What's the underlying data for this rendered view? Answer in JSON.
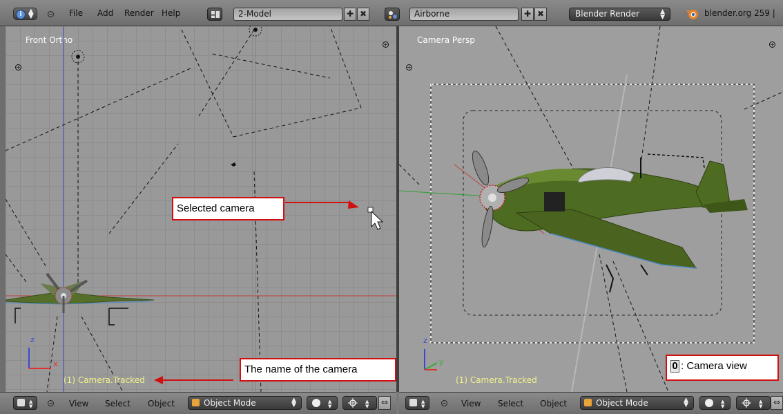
{
  "header": {
    "menu": [
      "File",
      "Add",
      "Render",
      "Help"
    ],
    "screen_layout": "2-Model",
    "scene": "Airborne",
    "render_engine": "Blender Render",
    "version_info": "blender.org 259 |"
  },
  "viewport_left": {
    "name": "Front Ortho",
    "object_label": "(1) Camera.Tracked"
  },
  "viewport_right": {
    "name": "Camera Persp",
    "object_label": "(1) Camera.Tracked"
  },
  "axes": {
    "x": "x",
    "y": "y",
    "z": "z"
  },
  "footer_left": {
    "menu": [
      "View",
      "Select",
      "Object"
    ],
    "mode": "Object Mode"
  },
  "footer_right": {
    "menu": [
      "View",
      "Select",
      "Object"
    ],
    "mode": "Object Mode"
  },
  "annotations": {
    "selected_camera": "Selected camera",
    "camera_name": "The name of the camera",
    "camera_view_key": "0",
    "camera_view_label": ": Camera view"
  },
  "colors": {
    "annotation_border": "#d01010",
    "object_label": "#f2f28c",
    "x_axis": "#e03030",
    "z_axis": "#3a4ad0",
    "plane_body": "#4e6b22"
  }
}
